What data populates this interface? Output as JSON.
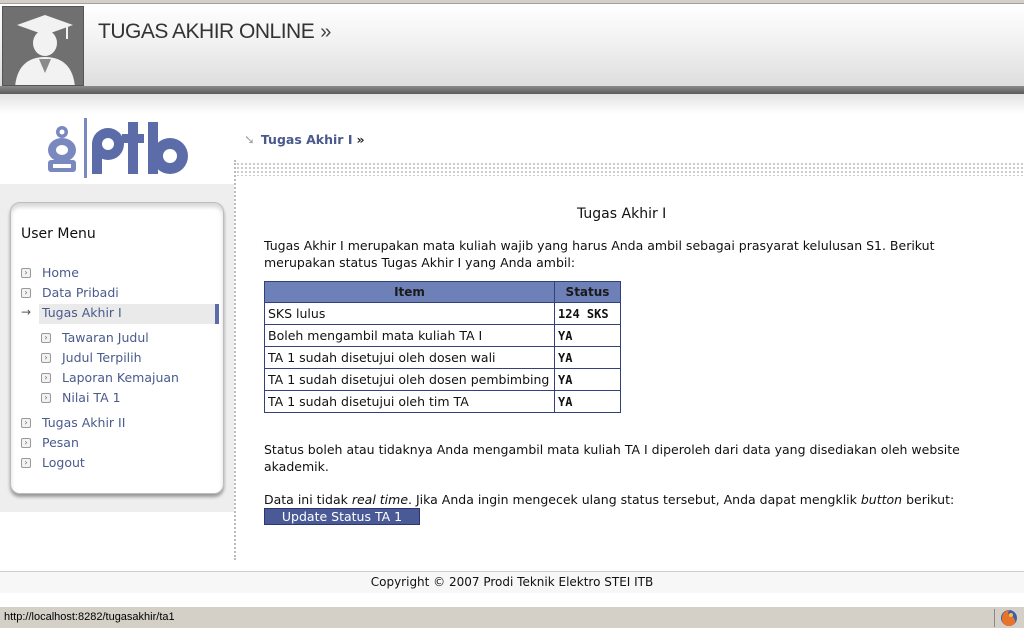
{
  "header": {
    "title": "TUGAS AKHIR ONLINE",
    "title_chevron": "»"
  },
  "sidebar": {
    "menu_title": "User Menu",
    "items": [
      {
        "label": "Home"
      },
      {
        "label": "Data Pribadi"
      },
      {
        "label": "Tugas Akhir I",
        "active": true
      },
      {
        "label": "Tawaran Judul",
        "sub": true
      },
      {
        "label": "Judul Terpilih",
        "sub": true
      },
      {
        "label": "Laporan Kemajuan",
        "sub": true
      },
      {
        "label": "Nilai TA 1",
        "sub": true
      },
      {
        "label": "Tugas Akhir II"
      },
      {
        "label": "Pesan"
      },
      {
        "label": "Logout"
      }
    ]
  },
  "breadcrumb": {
    "label": "Tugas Akhir I",
    "separator": "»"
  },
  "content": {
    "title": "Tugas Akhir I",
    "intro": "Tugas Akhir I merupakan mata kuliah wajib yang harus Anda ambil sebagai prasyarat kelulusan S1. Berikut merupakan status Tugas Akhir I yang Anda ambil:",
    "table": {
      "headers": [
        "Item",
        "Status"
      ],
      "rows": [
        [
          "SKS lulus",
          "124 SKS"
        ],
        [
          "Boleh mengambil mata kuliah TA I",
          "YA"
        ],
        [
          "TA 1 sudah disetujui oleh dosen wali",
          "YA"
        ],
        [
          "TA 1 sudah disetujui oleh dosen pembimbing",
          "YA"
        ],
        [
          "TA 1 sudah disetujui oleh tim TA",
          "YA"
        ]
      ]
    },
    "note1": "Status boleh atau tidaknya Anda mengambil mata kuliah TA I diperoleh dari data yang disediakan oleh website akademik.",
    "note2_a": "Data ini tidak ",
    "note2_em1": "real time",
    "note2_b": ". Jika Anda ingin mengecek ulang status tersebut, Anda dapat mengklik ",
    "note2_em2": "button",
    "note2_c": " berikut:",
    "button_label": "Update Status TA 1"
  },
  "footer": {
    "copyright": "Copyright © 2007 Prodi Teknik Elektro STEI ITB"
  },
  "statusbar": {
    "url": "http://localhost:8282/tugasakhir/ta1"
  },
  "colors": {
    "accent": "#4a5a96",
    "table_header": "#6e80b8",
    "link": "#4a5a8c"
  }
}
